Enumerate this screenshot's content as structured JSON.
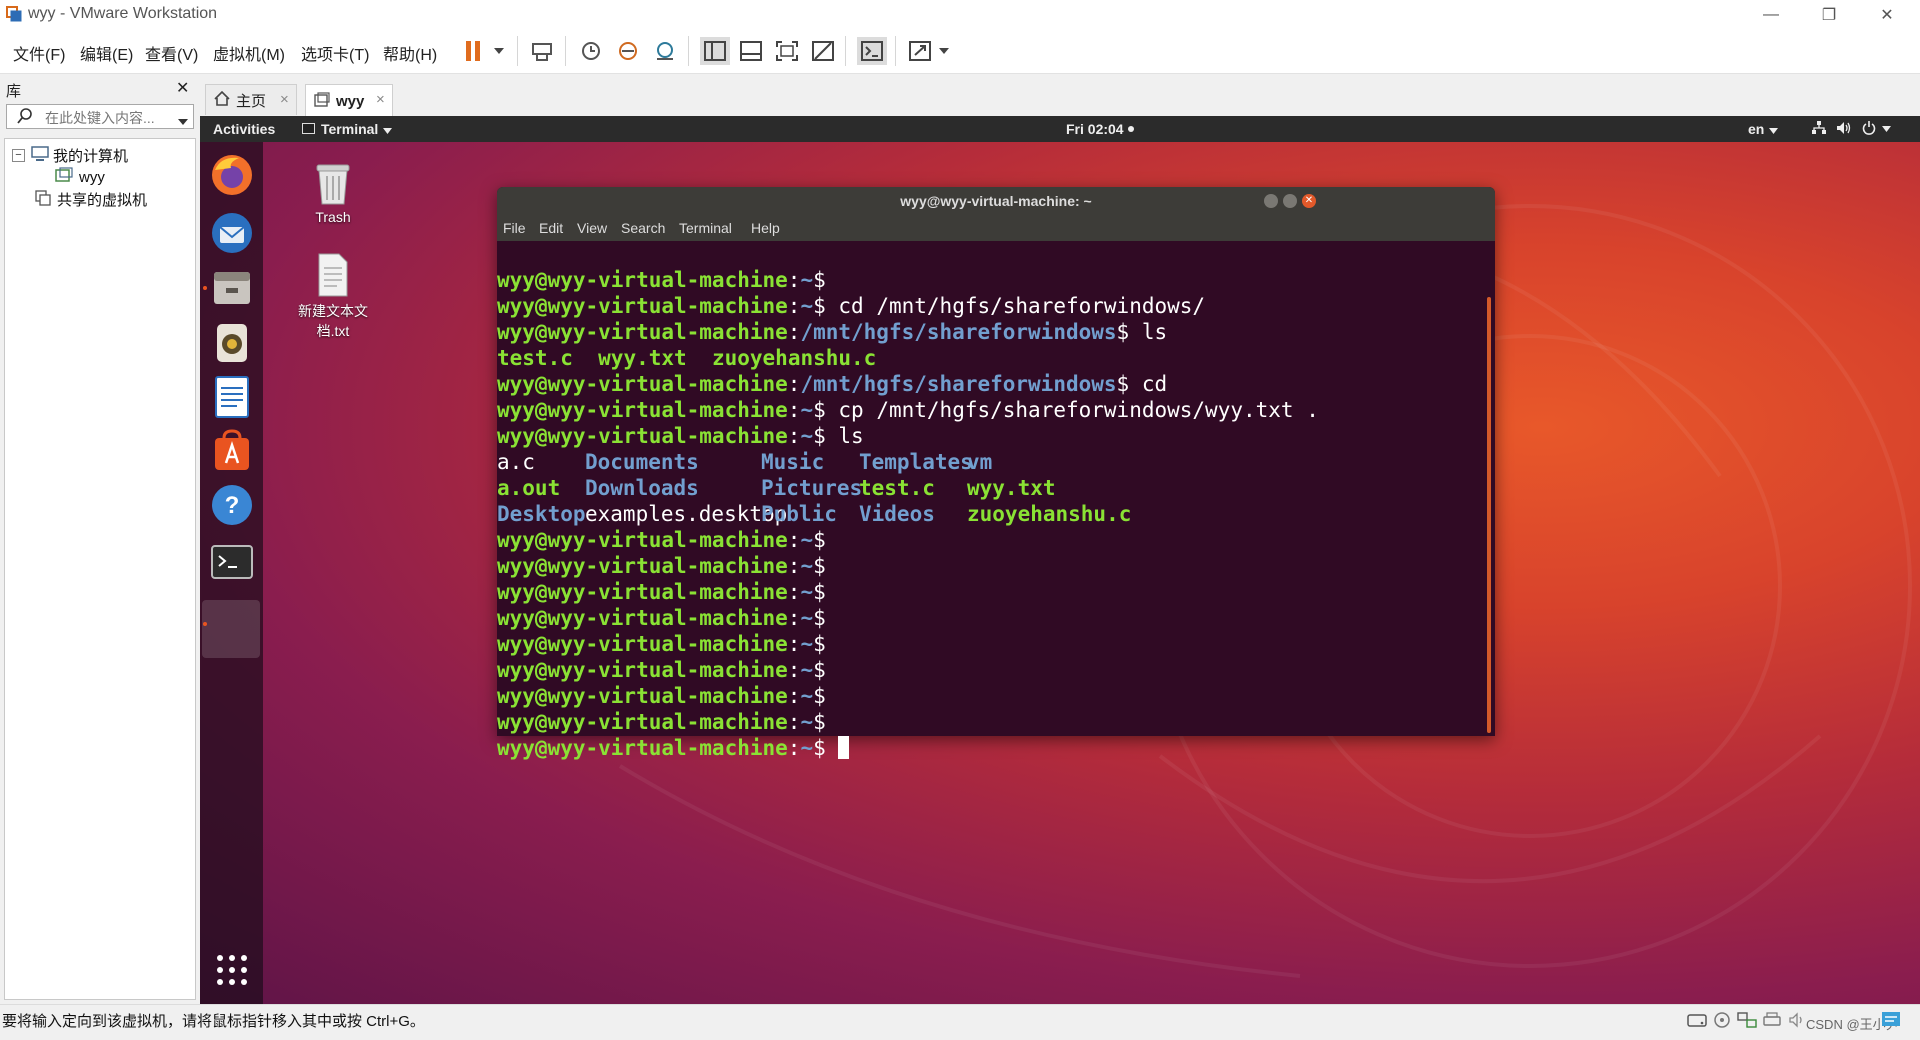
{
  "window": {
    "title": "wyy - VMware Workstation",
    "minimize": "—",
    "restore": "❐",
    "close": "✕"
  },
  "menu": [
    "文件(F)",
    "编辑(E)",
    "查看(V)",
    "虚拟机(M)",
    "选项卡(T)",
    "帮助(H)"
  ],
  "library": {
    "title": "库",
    "close": "✕",
    "search_placeholder": "在此处键入内容...",
    "tree": {
      "my_computer": "我的计算机",
      "vm": "wyy",
      "shared": "共享的虚拟机"
    }
  },
  "tabs": [
    {
      "label": "主页",
      "close": "×"
    },
    {
      "label": "wyy",
      "close": "×"
    }
  ],
  "ubuntu": {
    "activities": "Activities",
    "app_menu": "Terminal",
    "clock": "Fri 02:04",
    "lang": "en"
  },
  "desktop": {
    "trash": "Trash",
    "file_line1": "新建文本文",
    "file_line2": "档.txt"
  },
  "terminal": {
    "title": "wyy@wyy-virtual-machine: ~",
    "menu": [
      "File",
      "Edit",
      "View",
      "Search",
      "Terminal",
      "Help"
    ],
    "prompt_user": "wyy@wyy-virtual-machine",
    "cmd_cd_share": "cd /mnt/hgfs/shareforwindows/",
    "share_path": "/mnt/hgfs/shareforwindows",
    "cmd_ls": "ls",
    "cmd_cd": "cd",
    "cmd_cp": "cp /mnt/hgfs/shareforwindows/wyy.txt .",
    "share_files": [
      "test.c",
      "wyy.txt",
      "zuoyehanshu.c"
    ],
    "home_files": [
      [
        "a.c",
        "Documents",
        "Music",
        "Templates",
        "vm"
      ],
      [
        "a.out",
        "Downloads",
        "Pictures",
        "test.c",
        "wyy.txt"
      ],
      [
        "Desktop",
        "examples.desktop",
        "Public",
        "Videos",
        "zuoyehanshu.c"
      ]
    ]
  },
  "status": {
    "text": "要将输入定向到该虚拟机，请将鼠标指针移入其中或按 Ctrl+G。",
    "watermark": "CSDN @王小尹"
  }
}
